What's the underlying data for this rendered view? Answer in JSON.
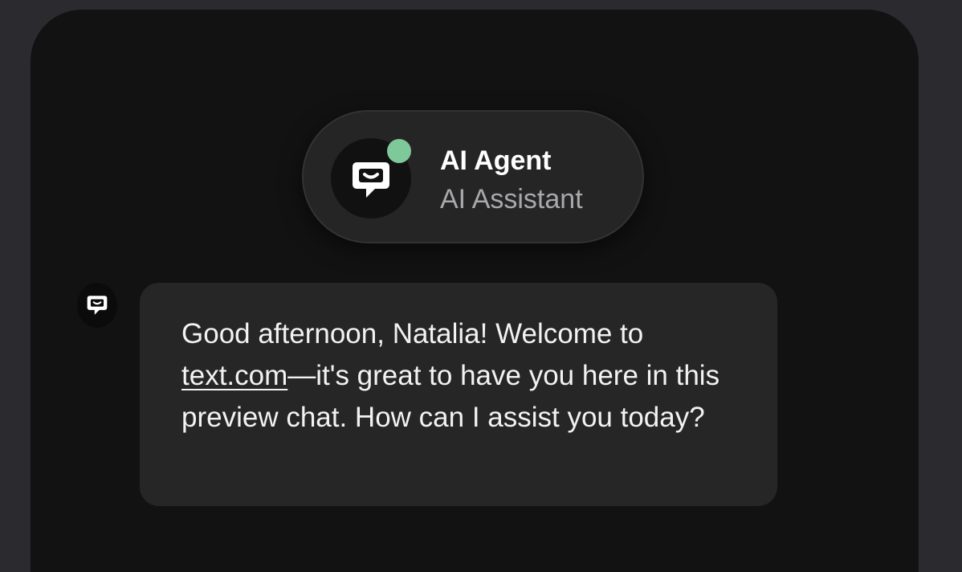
{
  "agent": {
    "name": "AI Agent",
    "role": "AI Assistant",
    "online": true,
    "status_color": "#7fc89a",
    "avatar_icon": "chat-bubble-logo-icon"
  },
  "message": {
    "sender_icon": "chat-bubble-logo-icon",
    "greeting": "Good afternoon, Natalia! Welcome to ",
    "link_text": "text.com",
    "rest": "—it's great to have you here in this preview chat. How can I assist you today?"
  },
  "colors": {
    "page_background": "#2b2a2f",
    "panel_background": "#121212",
    "bubble_background": "#262626"
  }
}
